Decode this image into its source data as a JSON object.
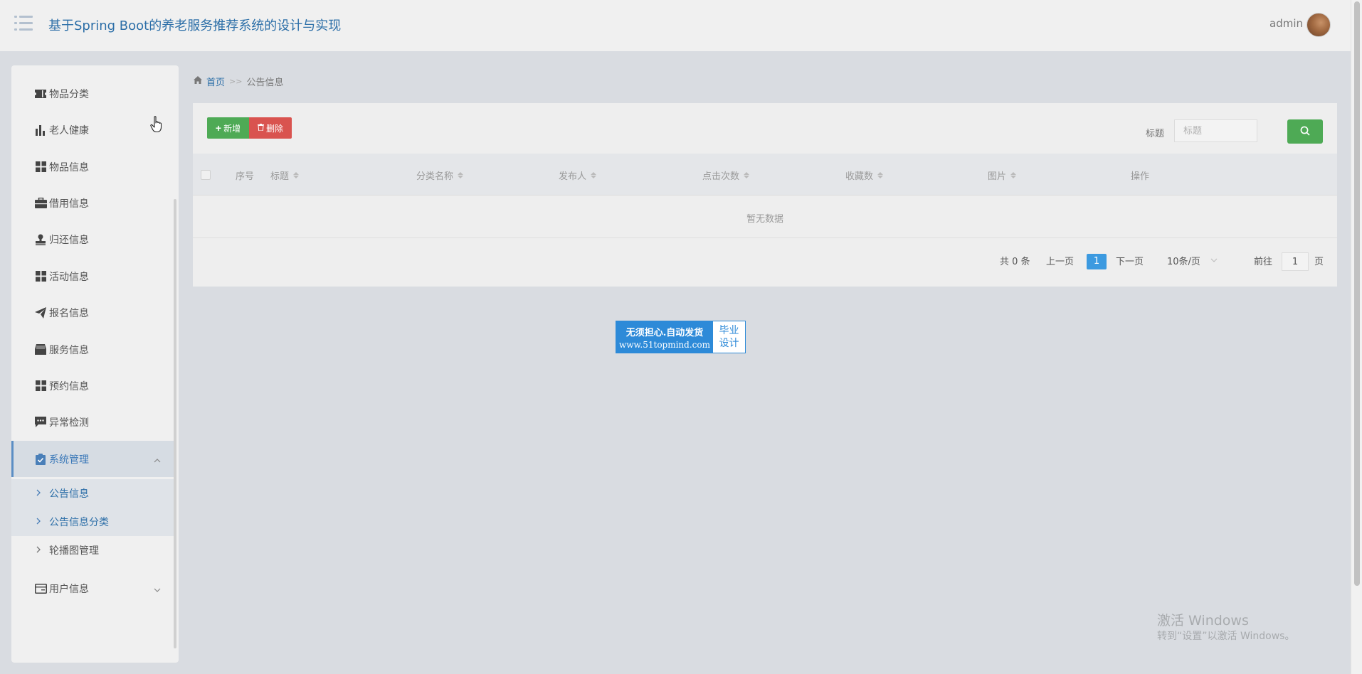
{
  "app": {
    "title": "基于Spring Boot的养老服务推荐系统的设计与实现",
    "user": "admin"
  },
  "sidebar": {
    "items": [
      {
        "label": "物品分类",
        "icon": "ticket-icon"
      },
      {
        "label": "老人健康",
        "icon": "bar-chart-icon"
      },
      {
        "label": "物品信息",
        "icon": "grid-icon"
      },
      {
        "label": "借用信息",
        "icon": "briefcase-icon"
      },
      {
        "label": "归还信息",
        "icon": "stamp-icon"
      },
      {
        "label": "活动信息",
        "icon": "grid-icon"
      },
      {
        "label": "报名信息",
        "icon": "paper-plane-icon"
      },
      {
        "label": "服务信息",
        "icon": "inbox-icon"
      },
      {
        "label": "预约信息",
        "icon": "grid-icon"
      },
      {
        "label": "异常检测",
        "icon": "comment-icon"
      }
    ],
    "system": {
      "label": "系统管理",
      "icon": "clipboard-check-icon",
      "expanded": true,
      "children": [
        {
          "label": "公告信息",
          "selected": true
        },
        {
          "label": "公告信息分类",
          "selected": false
        },
        {
          "label": "轮播图管理",
          "selected": false
        }
      ]
    },
    "user_info": {
      "label": "用户信息",
      "icon": "id-card-icon",
      "expanded": false
    }
  },
  "breadcrumb": {
    "home": "首页",
    "separator": ">>",
    "current": "公告信息"
  },
  "toolbar": {
    "add_label": "新增",
    "delete_label": "删除",
    "search_label": "标题",
    "search_placeholder": "标题"
  },
  "table": {
    "columns": [
      "序号",
      "标题",
      "分类名称",
      "发布人",
      "点击次数",
      "收藏数",
      "图片",
      "操作"
    ],
    "rows": [],
    "empty_text": "暂无数据"
  },
  "pagination": {
    "total_text": "共 0 条",
    "prev": "上一页",
    "next": "下一页",
    "current_page": "1",
    "page_size": "10条/页",
    "goto_label": "前往",
    "goto_value": "1",
    "page_suffix": "页"
  },
  "ad": {
    "line1": "无须担心.自动发货",
    "line2": "www.51topmind.com",
    "right1": "毕业",
    "right2": "设计"
  },
  "watermark": {
    "line1": "激活 Windows",
    "line2": "转到“设置”以激活 Windows。"
  },
  "colors": {
    "primary": "#2d6fa8",
    "success": "#4eaa55",
    "danger": "#d9534f",
    "page_active": "#3c9ae0"
  }
}
